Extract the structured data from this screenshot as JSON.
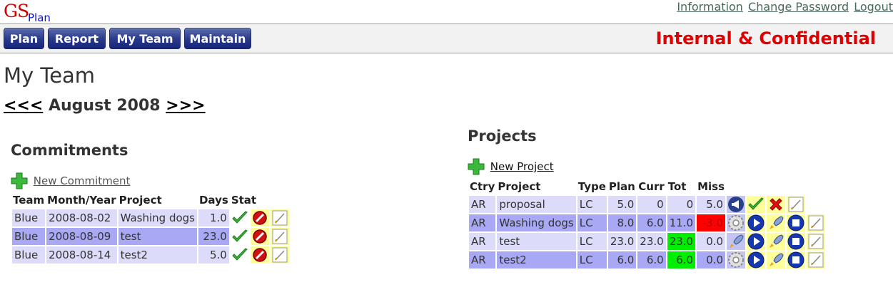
{
  "logo": {
    "gs": "GS",
    "plan": "Plan"
  },
  "top_links": [
    "Information",
    "Change Password",
    "Logout"
  ],
  "nav": [
    "Plan",
    "Report",
    "My Team",
    "Maintain"
  ],
  "confidential": "Internal & Confidential",
  "page_title": "My Team",
  "month_nav": {
    "prev": "<<<",
    "month": "August 2008",
    "next": ">>>"
  },
  "commitments": {
    "title": "Commitments",
    "new_label": "New Commitment",
    "headers": [
      "Team",
      "Month/Year",
      "Project",
      "Days",
      "Stat"
    ],
    "rows": [
      {
        "team": "Blue",
        "date": "2008-08-02",
        "project": "Washing dogs",
        "days": "1.0"
      },
      {
        "team": "Blue",
        "date": "2008-08-09",
        "project": "test",
        "days": "23.0"
      },
      {
        "team": "Blue",
        "date": "2008-08-14",
        "project": "test2",
        "days": "5.0"
      }
    ]
  },
  "projects": {
    "title": "Projects",
    "new_label": "New Project",
    "headers": [
      "Ctry",
      "Project",
      "Type",
      "Plan",
      "Curr",
      "Tot",
      "Miss"
    ],
    "rows": [
      {
        "ctry": "AR",
        "project": "proposal",
        "type": "LC",
        "plan": "5.0",
        "curr": "0",
        "tot": "0",
        "miss": "5.0",
        "status_icon": "megaphone-icon"
      },
      {
        "ctry": "AR",
        "project": "Washing dogs",
        "type": "LC",
        "plan": "8.0",
        "curr": "6.0",
        "tot": "11.0",
        "miss": "-3.0",
        "status_icon": "gear-icon"
      },
      {
        "ctry": "AR",
        "project": "test",
        "type": "LC",
        "plan": "23.0",
        "curr": "23.0",
        "tot": "23.0",
        "miss": "0.0",
        "status_icon": "rocket-icon"
      },
      {
        "ctry": "AR",
        "project": "test2",
        "type": "LC",
        "plan": "6.0",
        "curr": "6.0",
        "tot": "6.0",
        "miss": "0.0",
        "status_icon": "gear-icon"
      }
    ]
  },
  "colors": {
    "accent": "#e00000",
    "row_light": "#dcdcfa",
    "row_dark": "#a8a8f4",
    "negative": "#ff0000",
    "complete": "#00ee00",
    "action_cell": "#ffff9a"
  }
}
